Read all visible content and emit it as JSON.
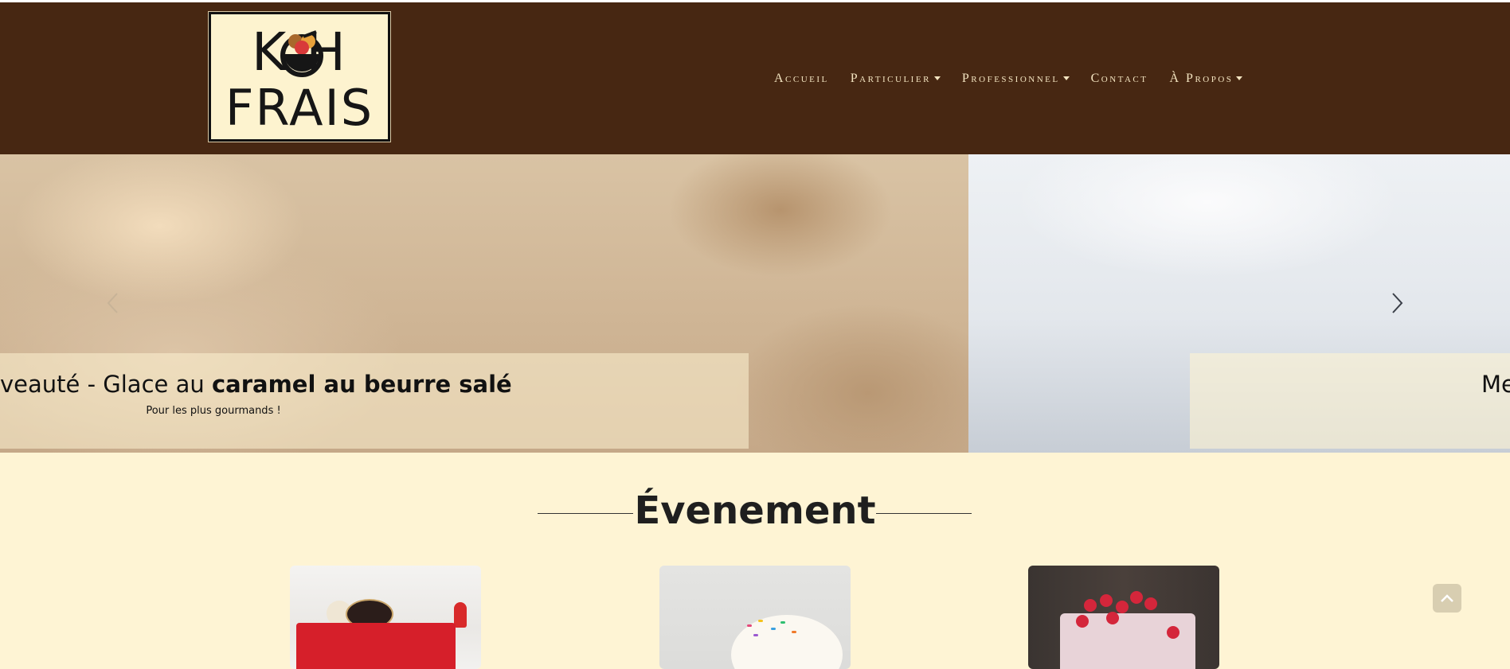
{
  "brand": {
    "line1": "K H",
    "line2": "FRAIS"
  },
  "nav": {
    "items": [
      {
        "label": "Accueil",
        "dropdown": false
      },
      {
        "label": "Particulier",
        "dropdown": true
      },
      {
        "label": "Professionnel",
        "dropdown": true
      },
      {
        "label": "Contact",
        "dropdown": false
      },
      {
        "label": "À Propos",
        "dropdown": true
      }
    ]
  },
  "carousel": {
    "slide1": {
      "title_prefix": "veauté - Glace au ",
      "title_bold": "caramel au beurre salé",
      "subtitle": "Pour les plus gourmands !"
    },
    "slide2": {
      "title_prefix": "Me"
    },
    "prev_icon": "chevron-left-icon",
    "next_icon": "chevron-right-icon"
  },
  "section": {
    "title": "Évenement"
  },
  "colors": {
    "navbar": "#472712",
    "page_background": "#fef4d4",
    "nav_text": "#f3e4c0"
  },
  "scroll_top_icon": "chevron-up-icon"
}
